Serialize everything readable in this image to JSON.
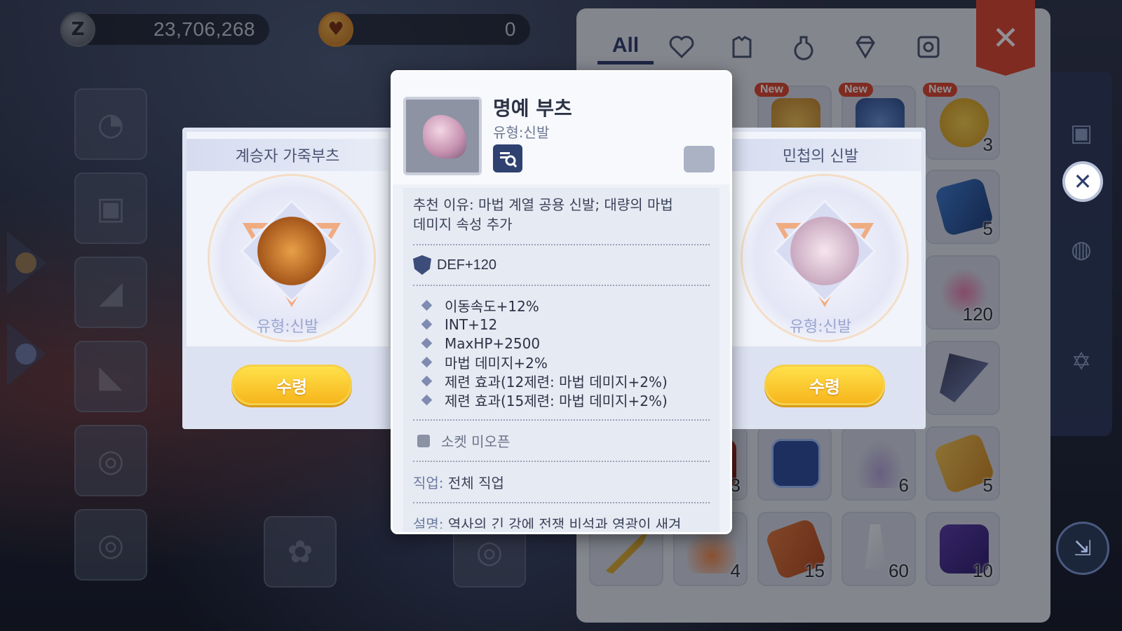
{
  "currency": {
    "zeny_icon": "Z",
    "zeny": "23,706,268",
    "secondary": "0"
  },
  "inventory": {
    "tab_all": "All",
    "tabs_icons": [
      "heart-icon",
      "armor-icon",
      "potion-icon",
      "diamond-icon",
      "card-icon"
    ],
    "new_label": "New",
    "counts": {
      "r1c4": "3",
      "r2c4": "5",
      "r3c4": "120",
      "r5c1": "3",
      "r5c3": "6",
      "r5c4": "5",
      "r6c2": "4",
      "r6c3": "15",
      "r6c4": "60",
      "r6c5": "10"
    }
  },
  "card_left": {
    "title": "계승자 가죽부츠",
    "type": "유형:신발",
    "button": "수령"
  },
  "card_right": {
    "title": "민첩의 신발",
    "type": "유형:신발",
    "button": "수령"
  },
  "tooltip": {
    "name": "명예 부츠",
    "type": "유형:신발",
    "reason_line1": "추천 이유: 마법 계열 공용 신발; 대량의 마법",
    "reason_line2": "데미지 속성 추가",
    "def": "DEF+120",
    "stats": [
      "이동속도+12%",
      "INT+12",
      "MaxHP+2500",
      "마법 데미지+2%",
      "제련 효과(12제련: 마법 데미지+2%)",
      "제련 효과(15제련: 마법 데미지+2%)"
    ],
    "socket": "소켓 미오픈",
    "job_label": "직업:",
    "job_value": "전체 직업",
    "desc_label": "설명:",
    "desc_value": "역사의 긴 강에 전쟁 비석과 영광이 새겨"
  },
  "colors": {
    "accent": "#2d3d6b",
    "close": "#e0452d",
    "claim": "#f7b51c"
  }
}
